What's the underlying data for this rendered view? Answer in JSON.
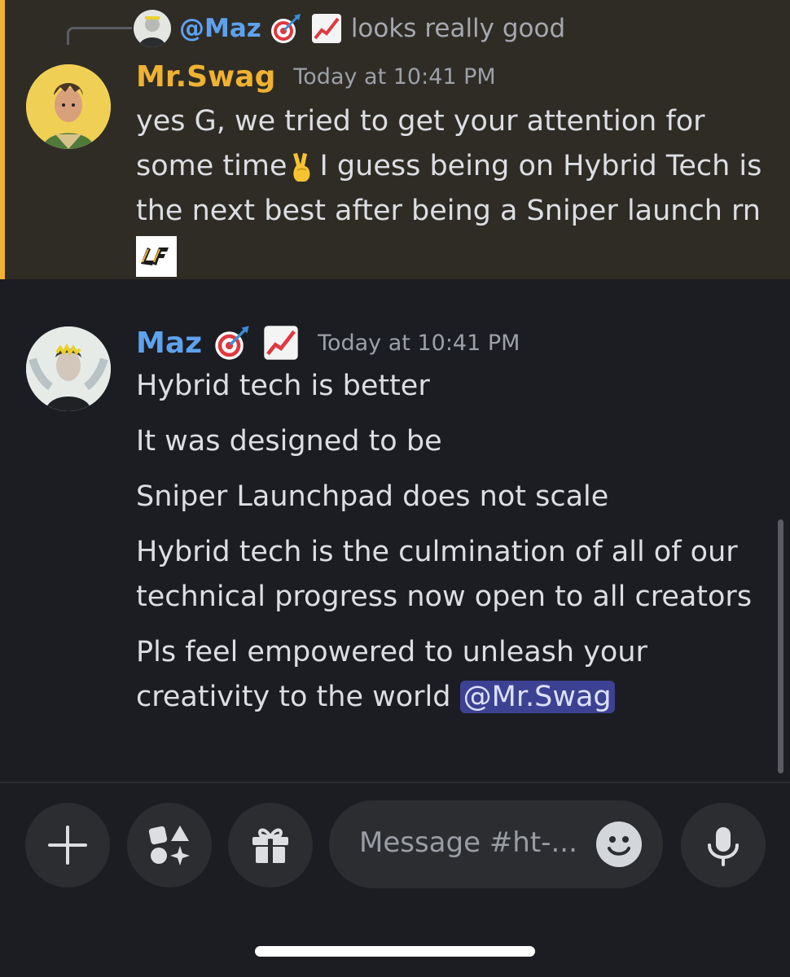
{
  "reply": {
    "author": "@Maz",
    "text": "looks really good"
  },
  "message1": {
    "author": "Mr.Swag",
    "timestamp": "Today at 10:41 PM",
    "lines": [
      "yes G, we tried to get your attention for",
      "some time",
      "I guess being on Hybrid Tech is",
      "the next best after being a Sniper launch rn"
    ]
  },
  "message2": {
    "author": "Maz",
    "timestamp": "Today at 10:41 PM",
    "lines": [
      "Hybrid tech is better",
      "It was designed to be",
      "Sniper Launchpad does not scale",
      "Hybrid tech is the culmination of all of our",
      "technical progress now open to all creators",
      "Pls feel empowered to unleash your",
      "creativity to the world"
    ],
    "mention": "@Mr.Swag"
  },
  "composer": {
    "placeholder": "Message #ht-..."
  },
  "icons": {
    "add": "plus-icon",
    "apps": "apps-icon",
    "gift": "gift-icon",
    "emoji": "emoji-icon",
    "mic": "microphone-icon",
    "dart": "dart-target-emoji",
    "chart": "chart-increasing-emoji",
    "peace": "victory-hand-emoji"
  },
  "colors": {
    "accent_name_swag": "#f0b232",
    "accent_name_maz": "#5ea2ee",
    "mention_bg": "#3c4192"
  }
}
